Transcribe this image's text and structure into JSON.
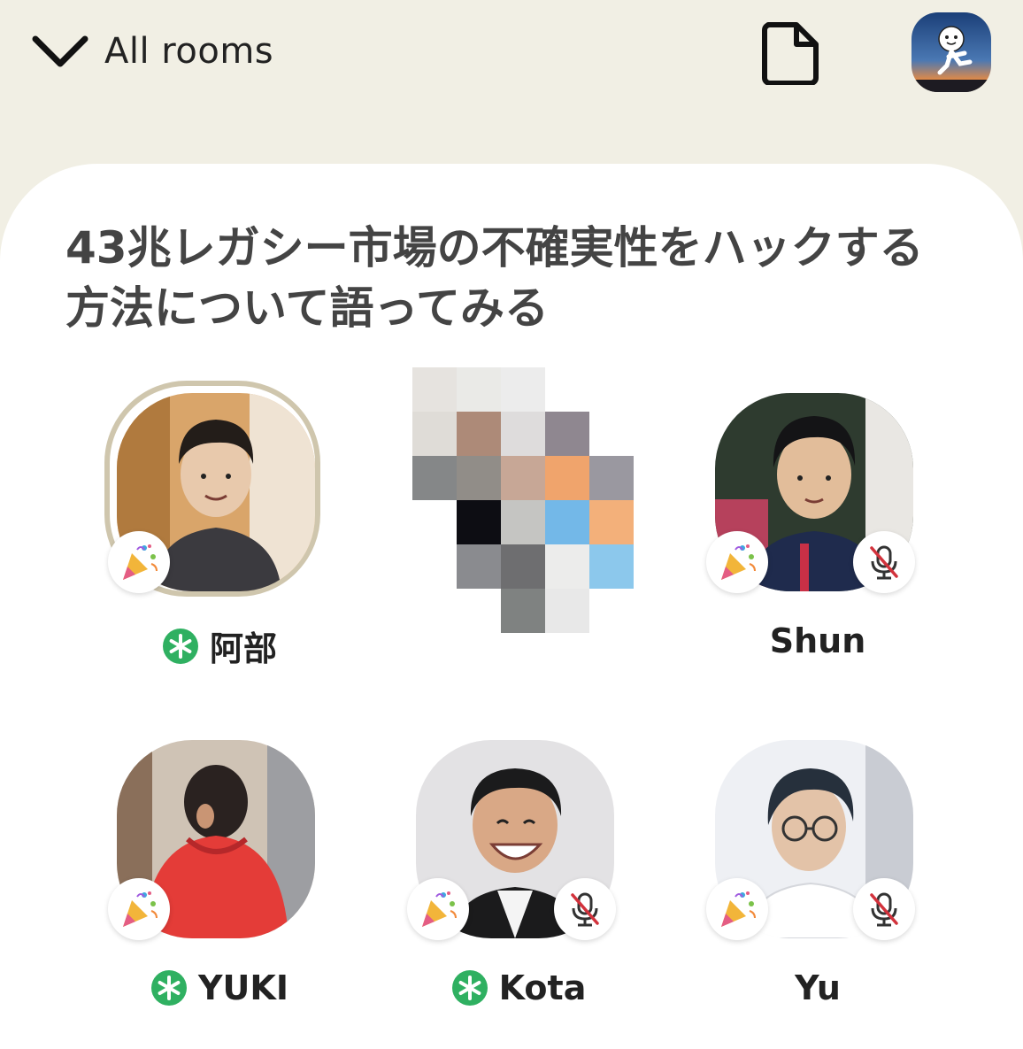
{
  "header": {
    "back_label": "All rooms",
    "icons": {
      "back": "chevron-down-icon",
      "document": "document-icon",
      "profile": "profile-avatar"
    }
  },
  "room": {
    "title": "43兆レガシー市場の不確実性をハックする方法について語ってみる"
  },
  "speakers": [
    {
      "name": "阿部",
      "moderator": true,
      "muted": false,
      "speaking": true,
      "new_user_badge": true,
      "photo_colors": [
        "#c99258",
        "#3b3a3d",
        "#e7d2bf"
      ]
    },
    {
      "name": "",
      "moderator": false,
      "muted": false,
      "speaking": false,
      "new_user_badge": false,
      "pixelated": true
    },
    {
      "name": "Shun",
      "moderator": false,
      "muted": true,
      "speaking": false,
      "new_user_badge": true,
      "photo_colors": [
        "#2f4a2c",
        "#1f2a4a",
        "#d9b89a"
      ]
    },
    {
      "name": "YUKI",
      "moderator": true,
      "muted": false,
      "speaking": false,
      "new_user_badge": true,
      "photo_colors": [
        "#d7c9ba",
        "#e43c38",
        "#2a2220"
      ]
    },
    {
      "name": "Kota",
      "moderator": true,
      "muted": true,
      "speaking": false,
      "new_user_badge": true,
      "photo_colors": [
        "#e3e2e4",
        "#1b1b1c",
        "#d7a88a"
      ]
    },
    {
      "name": "Yu",
      "moderator": false,
      "muted": true,
      "speaking": false,
      "new_user_badge": true,
      "photo_colors": [
        "#eef0f4",
        "#26303c",
        "#e3c3a8"
      ]
    }
  ],
  "colors": {
    "background": "#f1efe4",
    "panel": "#ffffff",
    "moderator_green": "#2fb061",
    "speaking_ring": "#cfc6ad",
    "mute_red": "#d2323c"
  }
}
